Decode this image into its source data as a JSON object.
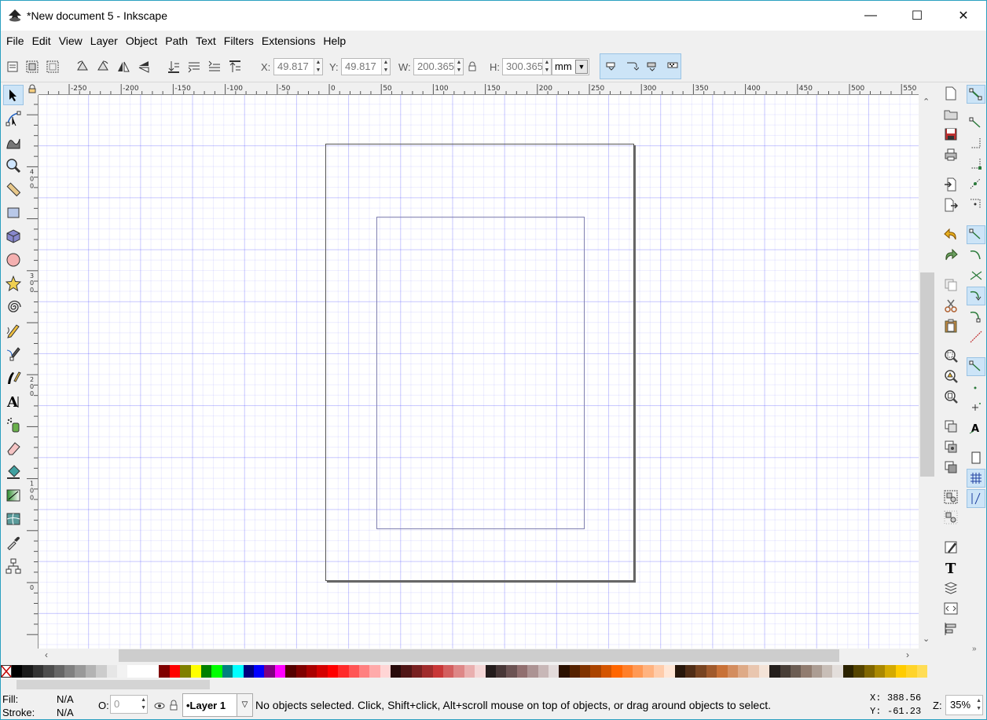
{
  "window": {
    "title": "*New document 5 - Inkscape",
    "minimize": "—",
    "maximize": "☐",
    "close": "✕"
  },
  "menu": [
    "File",
    "Edit",
    "View",
    "Layer",
    "Object",
    "Path",
    "Text",
    "Filters",
    "Extensions",
    "Help"
  ],
  "controls": {
    "x_label": "X:",
    "x_value": "49.817",
    "y_label": "Y:",
    "y_value": "49.817",
    "w_label": "W:",
    "w_value": "200.365",
    "h_label": "H:",
    "h_value": "300.365",
    "unit": "mm"
  },
  "ruler_top_ticks": [
    "-250",
    "-200",
    "-150",
    "-100",
    "-50",
    "0",
    "50",
    "100",
    "150",
    "200",
    "250",
    "300",
    "350",
    "400",
    "450",
    "500",
    "550"
  ],
  "ruler_left_ticks": [
    "400",
    "300",
    "200",
    "100",
    "0"
  ],
  "tools": [
    "selector-tool",
    "node-tool",
    "tweak-tool",
    "zoom-tool",
    "measure-tool",
    "rectangle-tool",
    "3dbox-tool",
    "ellipse-tool",
    "star-tool",
    "spiral-tool",
    "pencil-tool",
    "pen-tool",
    "calligraphy-tool",
    "text-tool",
    "spray-tool",
    "eraser-tool",
    "bucket-tool",
    "gradient-tool",
    "mesh-tool",
    "dropper-tool",
    "connector-tool"
  ],
  "palette": [
    "#000000",
    "#1a1a1a",
    "#333333",
    "#4d4d4d",
    "#666666",
    "#808080",
    "#999999",
    "#b3b3b3",
    "#cccccc",
    "#e6e6e6",
    "#f2f2f2",
    "#ffffff",
    "#ffffff",
    "#ffffff",
    "#800000",
    "#ff0000",
    "#808000",
    "#ffff00",
    "#008000",
    "#00ff00",
    "#008080",
    "#00ffff",
    "#000080",
    "#0000ff",
    "#800080",
    "#ff00ff",
    "#550000",
    "#800000",
    "#aa0000",
    "#d40000",
    "#ff0000",
    "#ff2a2a",
    "#ff5555",
    "#ff8080",
    "#ffaaaa",
    "#ffd5d5",
    "#280b0b",
    "#501616",
    "#782121",
    "#a02c2c",
    "#c83737",
    "#d35f5f",
    "#de8787",
    "#e9afaf",
    "#f4d7d7",
    "#241c1c",
    "#483737",
    "#6c5353",
    "#916f6f",
    "#ac9393",
    "#c8b7b7",
    "#e3dbdb",
    "#2b1100",
    "#552200",
    "#803300",
    "#aa4400",
    "#d45500",
    "#ff6600",
    "#ff7f2a",
    "#ff9955",
    "#ffb380",
    "#ffccaa",
    "#ffe6d5",
    "#28170b",
    "#502d16",
    "#784421",
    "#a05a2c",
    "#c87137",
    "#d38d5f",
    "#deaa87",
    "#e9c6af",
    "#f4e3d7",
    "#241f1c",
    "#483e37",
    "#6c5d53",
    "#917c6f",
    "#ac9d93",
    "#c8beb7",
    "#e3dedb",
    "#2b2200",
    "#554400",
    "#806600",
    "#aa8800",
    "#d4aa00",
    "#ffcc00",
    "#ffd42a",
    "#ffdd55"
  ],
  "status": {
    "fill_label": "Fill:",
    "fill_value": "N/A",
    "stroke_label": "Stroke:",
    "stroke_value": "N/A",
    "opacity_label": "O:",
    "opacity_value": "0",
    "layer": "•Layer 1",
    "message": "No objects selected. Click, Shift+click, Alt+scroll mouse on top of objects, or drag around objects to select.",
    "coord_x_label": "X:",
    "coord_x": "388.56",
    "coord_y_label": "Y:",
    "coord_y": "-61.23",
    "zoom_label": "Z:",
    "zoom": "35%"
  }
}
